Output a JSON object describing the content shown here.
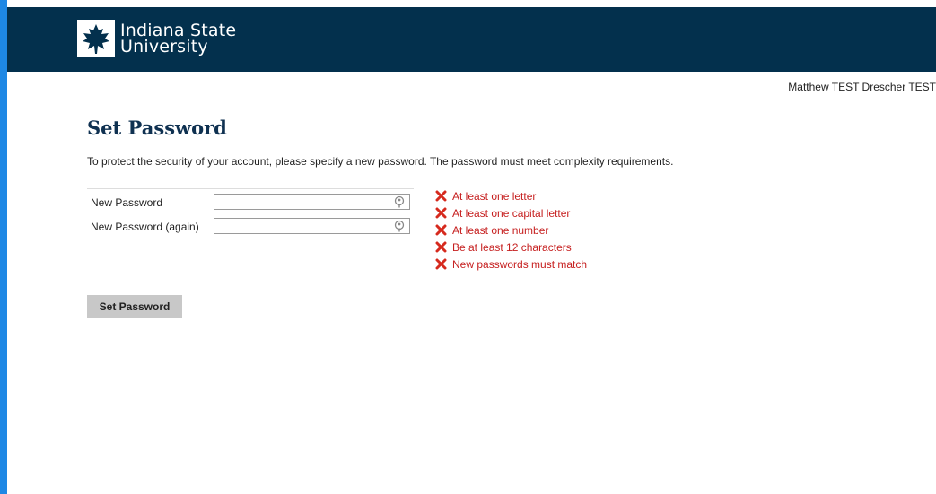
{
  "header": {
    "logo_line1": "Indiana State",
    "logo_line2": "University",
    "background_color": "#03304d",
    "logo_icon": "leaf-icon"
  },
  "user": {
    "display_name": "Matthew TEST Drescher TEST"
  },
  "page": {
    "title": "Set Password",
    "intro": "To protect the security of your account, please specify a new password. The password must meet complexity requirements."
  },
  "form": {
    "fields": [
      {
        "label": "New Password",
        "value": "",
        "icon": "key-icon"
      },
      {
        "label": "New Password (again)",
        "value": "",
        "icon": "key-icon"
      }
    ],
    "submit_label": "Set Password"
  },
  "requirements": {
    "status_icon": "x-icon",
    "status_color": "#c62020",
    "items": [
      "At least one letter",
      "At least one capital letter",
      "At least one number",
      "Be at least 12 characters",
      "New passwords must match"
    ]
  }
}
